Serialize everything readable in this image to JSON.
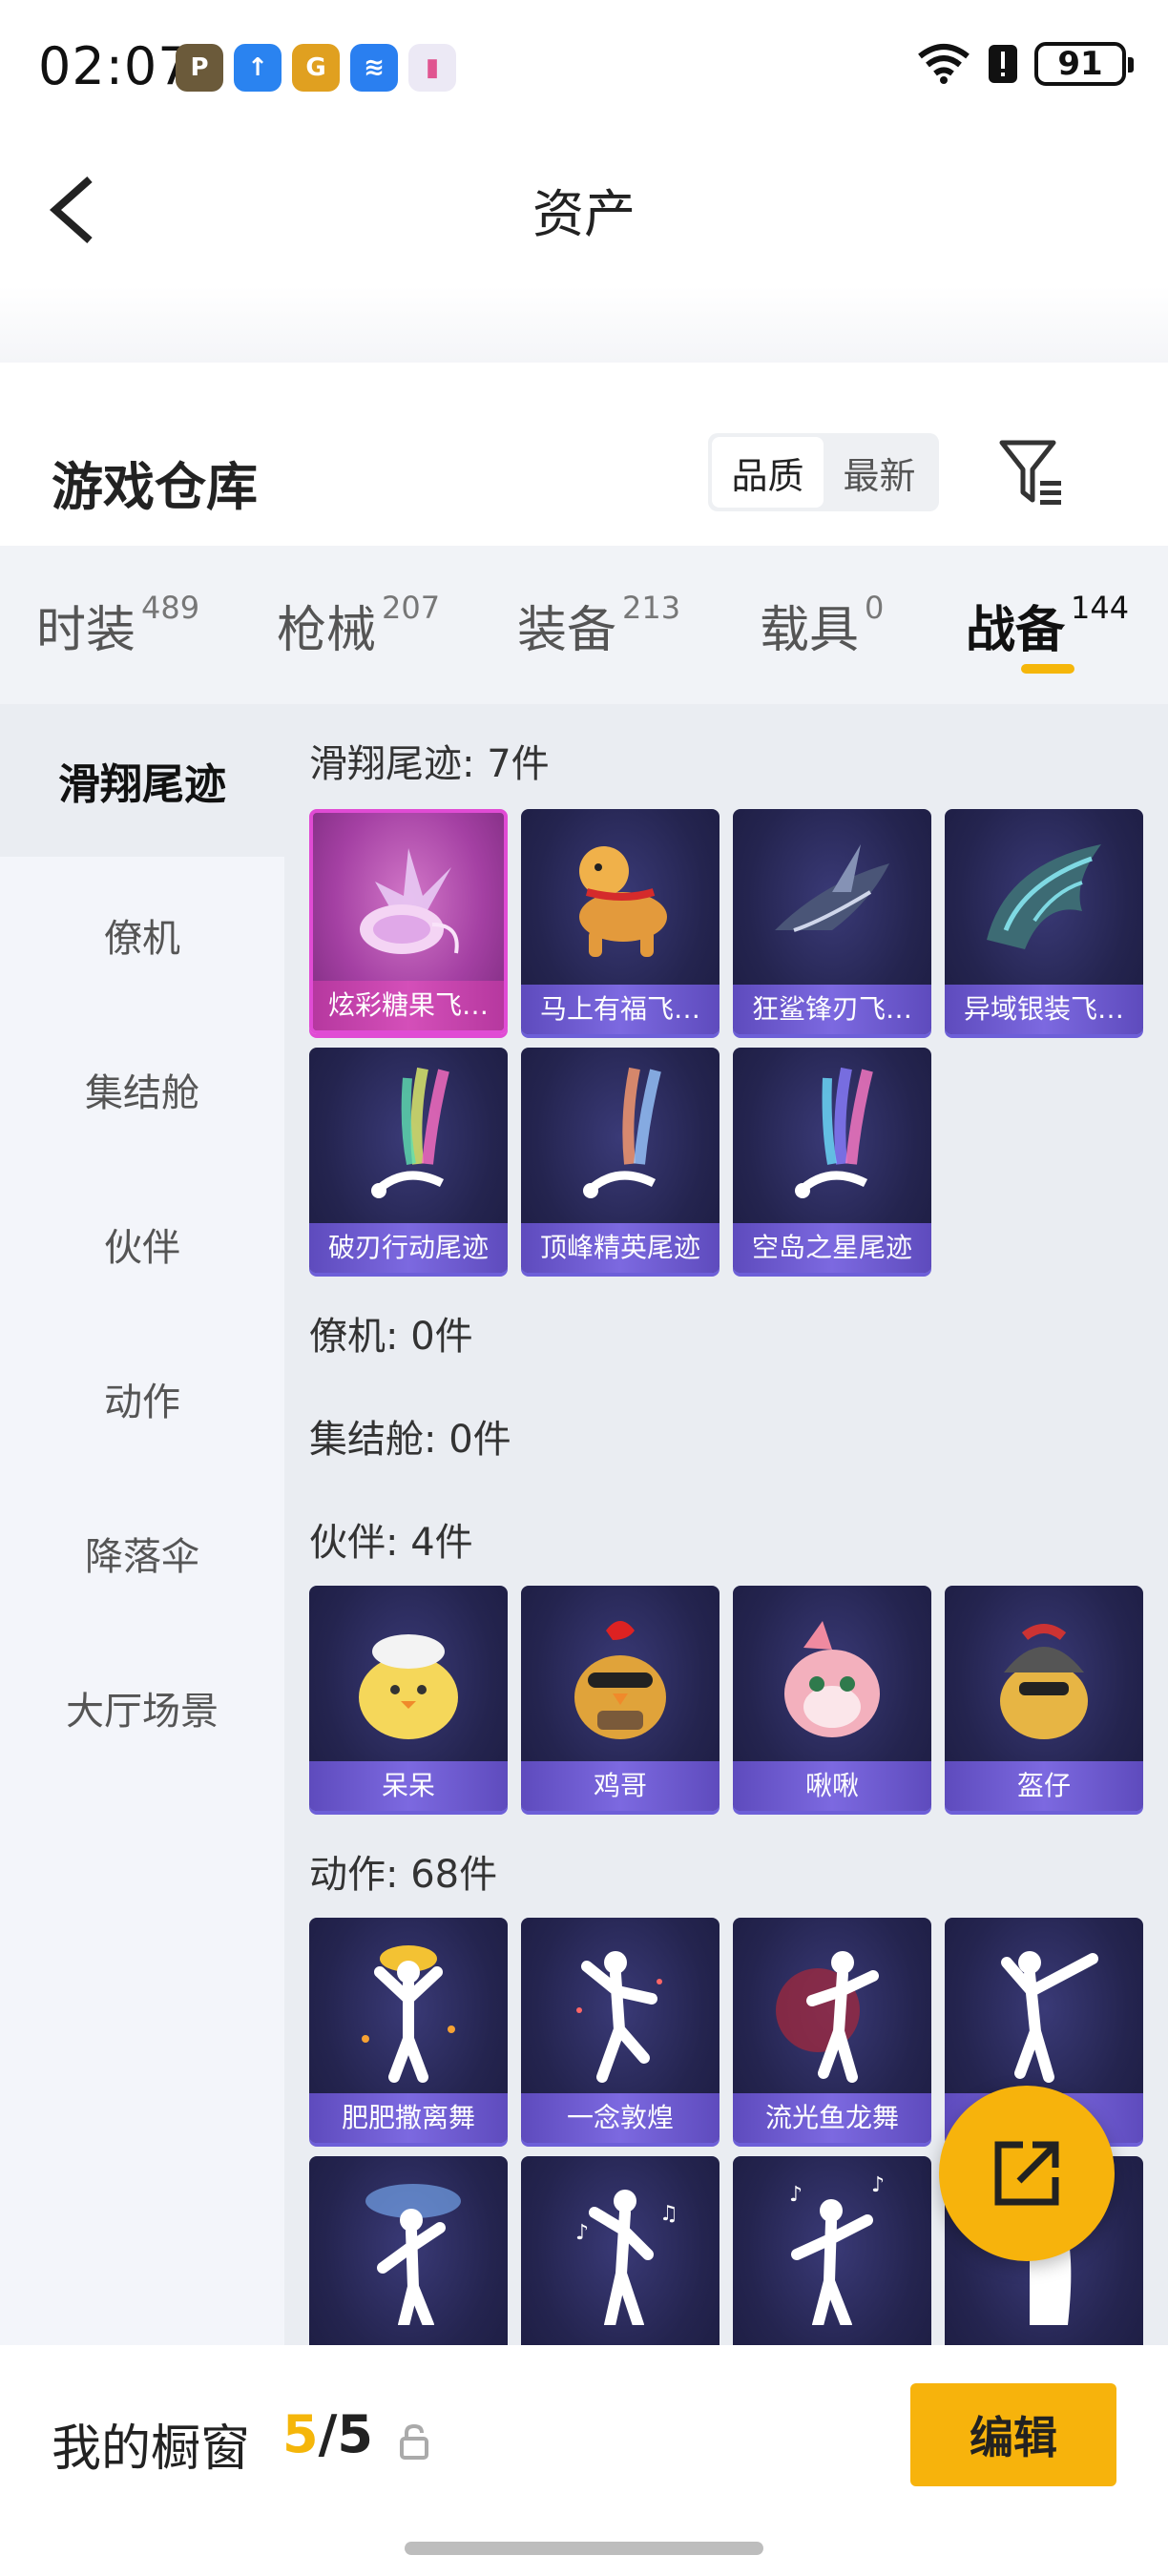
{
  "status_bar": {
    "time": "02:07",
    "battery": "91",
    "apps": [
      {
        "icon": "pubg-app-icon",
        "color": "#6b5a3a",
        "glyph": "P"
      },
      {
        "icon": "upload-app-icon",
        "color": "#2a83f0",
        "glyph": "↑"
      },
      {
        "icon": "game-app-icon",
        "color": "#e0a020",
        "glyph": "G"
      },
      {
        "icon": "wifi-app-icon",
        "color": "#2a7ff0",
        "glyph": "≋"
      },
      {
        "icon": "phone-app-icon",
        "color": "#f0f0f5",
        "glyph": "▮"
      }
    ]
  },
  "header": {
    "title": "资产"
  },
  "warehouse": {
    "title": "游戏仓库",
    "sort_quality": "品质",
    "sort_latest": "最新"
  },
  "tabs": [
    {
      "label": "时装",
      "count": "489"
    },
    {
      "label": "枪械",
      "count": "207"
    },
    {
      "label": "装备",
      "count": "213"
    },
    {
      "label": "载具",
      "count": "0"
    },
    {
      "label": "战备",
      "count": "144"
    }
  ],
  "sidebar": {
    "items": [
      "滑翔尾迹",
      "僚机",
      "集结舱",
      "伙伴",
      "动作",
      "降落伞",
      "大厅场景"
    ]
  },
  "sections": {
    "glide": {
      "title": "滑翔尾迹: 7件",
      "items": [
        "炫彩糖果飞…",
        "马上有福飞…",
        "狂鲨锋刃飞…",
        "异域银装飞…",
        "破刃行动尾迹",
        "顶峰精英尾迹",
        "空岛之星尾迹"
      ]
    },
    "wingman": {
      "title": "僚机: 0件"
    },
    "pod": {
      "title": "集结舱: 0件"
    },
    "partner": {
      "title": "伙伴: 4件",
      "items": [
        "呆呆",
        "鸡哥",
        "啾啾",
        "盔仔"
      ]
    },
    "emote": {
      "title": "动作: 68件",
      "items": [
        "肥肥撒离舞",
        "一念敦煌",
        "流光鱼龙舞",
        ""
      ]
    }
  },
  "bottom": {
    "label": "我的橱窗",
    "count_current": "5",
    "count_sep": "/",
    "count_total": "5",
    "edit": "编辑"
  },
  "colors": {
    "accent": "#f7b30c",
    "card_bg": "#24244f",
    "card_label": "#6d5fd8"
  }
}
